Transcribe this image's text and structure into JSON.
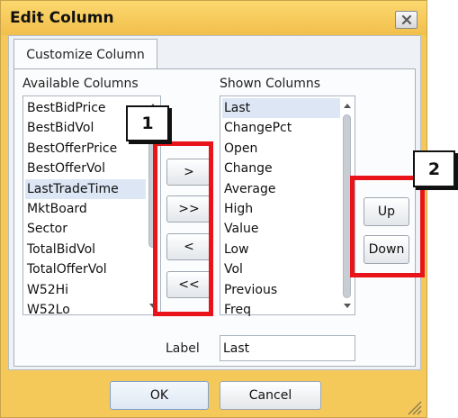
{
  "window": {
    "title": "Edit Column"
  },
  "tab": {
    "label": "Customize Column"
  },
  "available": {
    "header": "Available Columns",
    "items": [
      "BestBidPrice",
      "BestBidVol",
      "BestOfferPrice",
      "BestOfferVol",
      "LastTradeTime",
      "MktBoard",
      "Sector",
      "TotalBidVol",
      "TotalOfferVol",
      "W52Hi",
      "W52Lo"
    ],
    "selected": "LastTradeTime"
  },
  "shown": {
    "header": "Shown Columns",
    "items": [
      "Last",
      "ChangePct",
      "Open",
      "Change",
      "Average",
      "High",
      "Value",
      "Low",
      "Vol",
      "Previous",
      "Freq"
    ],
    "selected": "Last"
  },
  "transfer_buttons": {
    "add": ">",
    "add_all": ">>",
    "remove": "<",
    "remove_all": "<<"
  },
  "order_buttons": {
    "up": "Up",
    "down": "Down"
  },
  "label_field": {
    "label": "Label",
    "value": "Last"
  },
  "footer": {
    "ok": "OK",
    "cancel": "Cancel"
  },
  "callouts": {
    "first": "1",
    "second": "2"
  },
  "colors": {
    "window_frame": "#f5c85a",
    "selection": "#dce6f4",
    "highlight_box": "#e8141a"
  }
}
